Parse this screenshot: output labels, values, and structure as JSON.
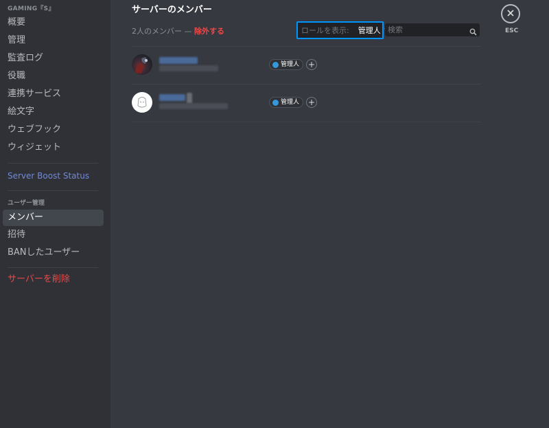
{
  "sidebar": {
    "header": "GAMING『S』",
    "items": [
      {
        "label": "概要"
      },
      {
        "label": "管理"
      },
      {
        "label": "監査ログ"
      },
      {
        "label": "役職"
      },
      {
        "label": "連携サービス"
      },
      {
        "label": "絵文字"
      },
      {
        "label": "ウェブフック"
      },
      {
        "label": "ウィジェット"
      }
    ],
    "boost": "Server Boost Status",
    "user_section": "ユーザー管理",
    "user_items": [
      {
        "label": "メンバー"
      },
      {
        "label": "招待"
      },
      {
        "label": "BANしたユーザー"
      }
    ],
    "delete": "サーバーを削除"
  },
  "main": {
    "title": "サーバーのメンバー",
    "member_count": "2人のメンバー — ",
    "prune": "除外する",
    "role_filter": {
      "label": "ロールを表示:",
      "value": "管理人"
    },
    "search": {
      "placeholder": "検索"
    },
    "close": {
      "icon": "close-icon",
      "label": "ESC"
    },
    "members": [
      {
        "role": "管理人",
        "role_color": "#3498db"
      },
      {
        "role": "管理人",
        "role_color": "#3498db"
      }
    ]
  },
  "colors": {
    "accent": "#7289da",
    "danger": "#f04747",
    "focus": "#0096ff",
    "role": "#3498db"
  }
}
